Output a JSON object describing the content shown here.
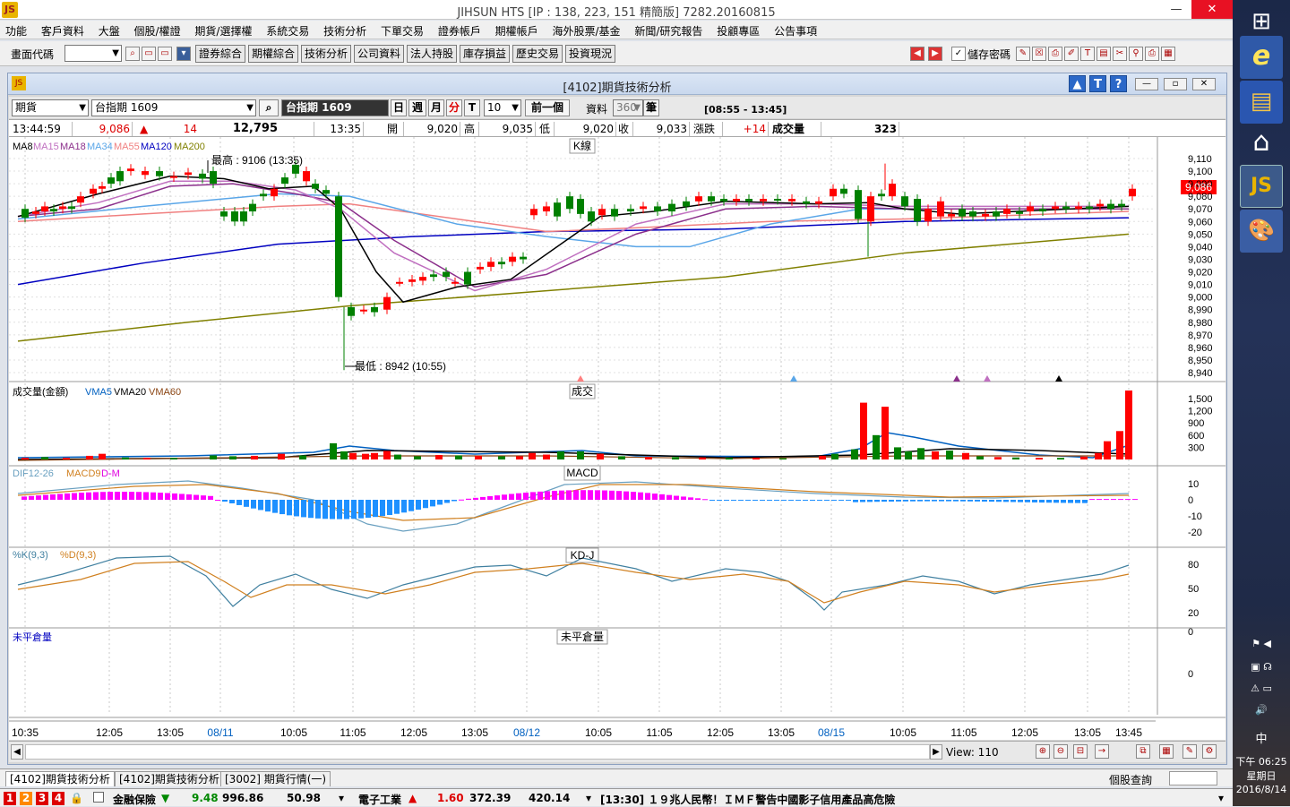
{
  "window": {
    "title": "JIHSUN HTS     [IP : 138, 223, 151 精簡版] 7282.20160815"
  },
  "menu": [
    "功能",
    "客戶資料",
    "大盤",
    "個股/權證",
    "期貨/選擇權",
    "系統交易",
    "技術分析",
    "下單交易",
    "證券帳戶",
    "期權帳戶",
    "海外股票/基金",
    "新聞/研究報告",
    "投顧專區",
    "公告事項"
  ],
  "toolbar": {
    "code_label": "畫面代碼",
    "buttons": [
      "證券綜合",
      "期權綜合",
      "技術分析",
      "公司資料",
      "法人持股",
      "庫存損益",
      "歷史交易",
      "投資現況"
    ],
    "save_pw_label": "儲存密碼"
  },
  "child": {
    "title": "[4102]期貨技術分析",
    "icons": [
      "▲",
      "T",
      "?"
    ]
  },
  "controls": {
    "market": "期貨",
    "symbol": "台指期 1609",
    "symbol_dark": "台指期 1609",
    "period_buttons": [
      "日",
      "週",
      "月",
      "分",
      "T"
    ],
    "interval": "10",
    "prev_btn": "前一個",
    "data_label": "資料",
    "data_count": "360",
    "unit_label": "筆",
    "session": "[08:55 - 13:45]"
  },
  "quote": {
    "time": "13:44:59",
    "price": "9,086",
    "change": "14",
    "volume": "12,795",
    "last_time": "13:35",
    "open_label": "開",
    "open": "9,020",
    "high_label": "高",
    "high": "9,035",
    "low_label": "低",
    "low": "9,020",
    "close_label": "收",
    "close": "9,033",
    "chg_label": "漲跌",
    "chg": "+14",
    "vol_label": "成交量",
    "vol": "323"
  },
  "panels": {
    "kline": {
      "legend": [
        "MA8",
        "MA15",
        "MA18",
        "MA34",
        "MA55",
        "MA120",
        "MA200"
      ],
      "legend_colors": [
        "#000000",
        "#c070c0",
        "#8b2f8b",
        "#5aa6e8",
        "#f08080",
        "#0000c0",
        "#808000"
      ],
      "title": "K線",
      "high_note": "最高 : 9106 (13:35)",
      "low_note": "最低 : 8942 (10:55)",
      "price_tag": "9,086",
      "yticks": [
        "9,110",
        "9,100",
        "9,090",
        "9,080",
        "9,070",
        "9,060",
        "9,050",
        "9,040",
        "9,030",
        "9,020",
        "9,010",
        "9,000",
        "8,990",
        "8,980",
        "8,970",
        "8,960",
        "8,950",
        "8,940"
      ]
    },
    "volume": {
      "legend": [
        "成交量(金額)",
        "VMA5",
        "VMA20",
        "VMA60"
      ],
      "legend_colors": [
        "#000000",
        "#0060c0",
        "#000000",
        "#8b4513"
      ],
      "title": "成交",
      "yticks": [
        "1,500",
        "1,200",
        "900",
        "600",
        "300"
      ]
    },
    "macd": {
      "legend": [
        "DIF12-26",
        "MACD9",
        "D-M"
      ],
      "legend_colors": [
        "#6aa0c0",
        "#d08020",
        "#e000e0"
      ],
      "title": "MACD",
      "yticks": [
        "10",
        "0",
        "-10",
        "-20"
      ]
    },
    "kd": {
      "legend": [
        "%K(9,3)",
        "%D(9,3)"
      ],
      "legend_colors": [
        "#4080a0",
        "#d08020"
      ],
      "title": "KD-J",
      "yticks": [
        "80",
        "50",
        "20"
      ]
    },
    "oi": {
      "legend": [
        "未平倉量"
      ],
      "legend_colors": [
        "#0000c0"
      ],
      "title": "未平倉量",
      "yticks": [
        "0",
        "0"
      ]
    }
  },
  "xaxis": [
    "10:35",
    "12:05",
    "13:05",
    "08/11",
    "10:05",
    "11:05",
    "12:05",
    "13:05",
    "08/12",
    "10:05",
    "11:05",
    "12:05",
    "13:05",
    "08/15",
    "10:05",
    "11:05",
    "12:05",
    "13:05",
    "13:45"
  ],
  "scroll": {
    "view_label": "View: 110"
  },
  "tabs": [
    "[4102]期貨技術分析",
    "[4102]期貨技術分析",
    "[3002] 期貨行情(一)"
  ],
  "right_bottom": {
    "label": "個股查詢"
  },
  "ticker": {
    "nums": [
      "1",
      "2",
      "3",
      "4"
    ],
    "item1_name": "金融保險",
    "item1_chg": "9.48",
    "item1_val": "996.86",
    "item1_vol": "50.98",
    "item2_name": "電子工業",
    "item2_chg": "1.60",
    "item2_val": "372.39",
    "item2_vol": "420.14",
    "news": "[13:30] １９兆人民幣！ＩＭＦ警告中國影子信用產品高危險"
  },
  "clock": {
    "time": "下午 06:25",
    "day": "星期日",
    "date": "2016/8/14",
    "ime": "中"
  },
  "colors": {
    "up": "#ff0000",
    "down": "#008000",
    "accent": "#0060c0"
  }
}
